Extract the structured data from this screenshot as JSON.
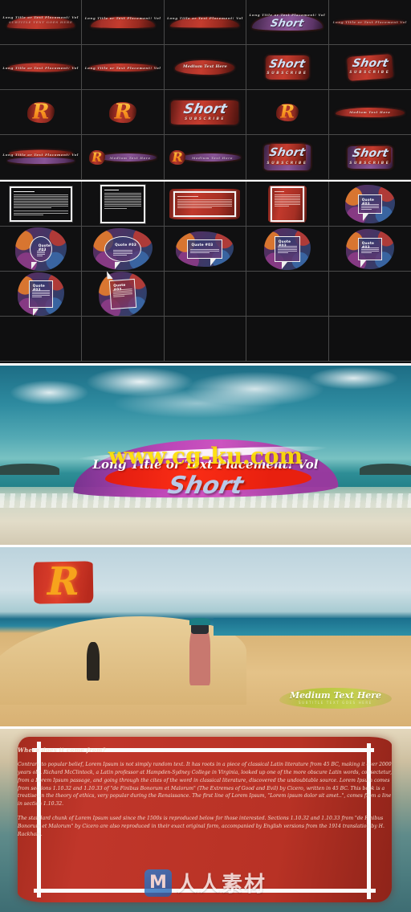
{
  "product": {
    "main_title": "Long Title or Text Placement! Vol",
    "short_word": "Short",
    "subscribe_word": "SUBSCRIBE",
    "medium_text": "Medium Text Here",
    "medium_subtext": "SUBTITLE TEXT GOES HERE",
    "logo_letter": "R",
    "quote_label": "Quote #03"
  },
  "watermarks": {
    "url": "www.cg-ku.com",
    "logo_letter": "M",
    "site_name": "人人素材"
  },
  "grid_a": {
    "rows": [
      [
        {
          "kind": "arc-text",
          "label": "Long Title or Text Placement! Vol",
          "sub": "SUBTITLE TEXT GOES HERE"
        },
        {
          "kind": "arc-text",
          "label": "Long Title or Text Placement! Vol",
          "sub": ""
        },
        {
          "kind": "arc-text",
          "label": "Long Title or Text Placement! Vol",
          "sub": ""
        },
        {
          "kind": "short-arc",
          "label": "Long Title or Text Placement! Vol",
          "big": "Short"
        },
        {
          "kind": "thin-text",
          "label": "Long Title or Text Placement Vol",
          "sub": ""
        }
      ],
      [
        {
          "kind": "bar-text",
          "label": "Long Title or Text Placement! Vol",
          "sub": ""
        },
        {
          "kind": "bar-text",
          "label": "Long Title or Text Placement! Vol",
          "sub": ""
        },
        {
          "kind": "bar-text",
          "label": "Medium Text Here",
          "sub": ""
        },
        {
          "kind": "short-block",
          "big": "Short",
          "sub": "SUBSCRIBE"
        },
        {
          "kind": "short-block",
          "big": "Short",
          "sub": "SUBSCRIBE"
        }
      ],
      [
        {
          "kind": "logo",
          "label": "R"
        },
        {
          "kind": "logo",
          "label": "R"
        },
        {
          "kind": "short-wide",
          "big": "Short",
          "sub": "SUBSCRIBE"
        },
        {
          "kind": "logo",
          "label": "R"
        },
        {
          "kind": "bar-text",
          "label": "Medium Text Here",
          "sub": ""
        }
      ],
      [
        {
          "kind": "bar-purple",
          "label": "Long Title or Text Placement! Vol",
          "sub": ""
        },
        {
          "kind": "logo-bar",
          "label": "R",
          "sub": "Medium Text Here"
        },
        {
          "kind": "logo-bar",
          "label": "R",
          "sub": "Medium Text Here"
        },
        {
          "kind": "short-purple",
          "big": "Short",
          "sub": "SUBSCRIBE"
        },
        {
          "kind": "short-purple",
          "big": "Short",
          "sub": "SUBSCRIBE"
        }
      ]
    ]
  },
  "grid_b": {
    "rows": [
      [
        {
          "kind": "frame-white",
          "title": "Where does it come from?"
        },
        {
          "kind": "frame-white-tall",
          "title": "Where does it come from?"
        },
        {
          "kind": "frame-red-wide",
          "title": "Where does it come from?"
        },
        {
          "kind": "frame-red-tall",
          "title": "Where does it come from?"
        },
        {
          "kind": "bubble-box",
          "title": "Quote #03"
        }
      ],
      [
        {
          "kind": "bubble-round",
          "title": "Quote #03"
        },
        {
          "kind": "bubble-round-wide",
          "title": "Quote #03"
        },
        {
          "kind": "bubble-box-wide",
          "title": "Quote #03"
        },
        {
          "kind": "bubble-box-tall",
          "title": "Quote #03"
        },
        {
          "kind": "bubble-box-splat",
          "title": "Quote #03"
        }
      ],
      [
        {
          "kind": "bubble-box-tall2",
          "title": "Quote #03"
        },
        {
          "kind": "bubble-box-tilt",
          "title": "Quote #03"
        },
        {
          "kind": "empty",
          "title": ""
        },
        {
          "kind": "empty",
          "title": ""
        },
        {
          "kind": "empty",
          "title": ""
        }
      ],
      [
        {
          "kind": "empty",
          "title": ""
        },
        {
          "kind": "empty",
          "title": ""
        },
        {
          "kind": "empty",
          "title": ""
        },
        {
          "kind": "empty",
          "title": ""
        },
        {
          "kind": "empty",
          "title": ""
        }
      ]
    ]
  },
  "text_card": {
    "heading": "Where does it come from?",
    "paragraph1": "Contrary to popular belief, Lorem Ipsum is not simply random text. It has roots in a piece of classical Latin literature from 45 BC, making it over 2000 years old. Richard McClintock, a Latin professor at Hampden-Sydney College in Virginia, looked up one of the more obscure Latin words, consectetur, from a Lorem Ipsum passage, and going through the cites of the word in classical literature, discovered the undoubtable source. Lorem Ipsum comes from sections 1.10.32 and 1.10.33 of \"de Finibus Bonorum et Malorum\" (The Extremes of Good and Evil) by Cicero, written in 45 BC. This book is a treatise on the theory of ethics, very popular during the Renaissance. The first line of Lorem Ipsum, \"Lorem ipsum dolor sit amet..\", comes from a line in section 1.10.32.",
    "paragraph2": "The standard chunk of Lorem Ipsum used since the 1500s is reproduced below for those interested. Sections 1.10.32 and 1.10.33 from \"de Finibus Bonorum et Malorum\" by Cicero are also reproduced in their exact original form, accompanied by English versions from the 1914 translation by H. Rackham."
  }
}
